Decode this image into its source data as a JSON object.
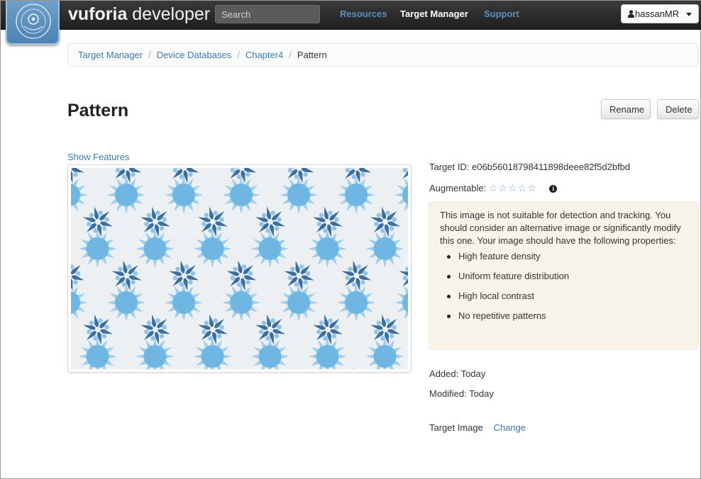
{
  "navbar": {
    "brand_bold": "vuforia",
    "brand_rest": " developer",
    "search_placeholder": "Search",
    "links": [
      {
        "label": "Resources",
        "active": false
      },
      {
        "label": "Target Manager",
        "active": true
      },
      {
        "label": "Support",
        "active": false
      }
    ],
    "user": "hassanMR"
  },
  "breadcrumb": {
    "items": [
      "Target Manager",
      "Device Databases",
      "Chapter4"
    ],
    "separator": "/",
    "current": "Pattern"
  },
  "page": {
    "title": "Pattern",
    "rename_label": "Rename",
    "delete_label": "Delete",
    "show_features": "Show Features"
  },
  "details": {
    "target_id_label": "Target ID:",
    "target_id": "e06b56018798411898deee82f5d2bfbd",
    "augmentable_label": "Augmentable:",
    "augmentable_rating": 0,
    "augmentable_max": 5,
    "warning_text": "This image is not suitable for detection and tracking. You should consider an alternative image or significantly modify this one. Your image should have the following properties:",
    "properties": [
      "High feature density",
      "Uniform feature distribution",
      "High local contrast",
      "No repetitive patterns"
    ],
    "added": "Added: Today",
    "modified": "Modified: Today",
    "target_image_label": "Target Image",
    "change_label": "Change"
  },
  "colors": {
    "link": "#3d7ab0",
    "nav_link": "#5b8fc4",
    "warning_bg": "#f8f4ea",
    "snowflake_light": "#6fb6e2",
    "snowflake_dark": "#3d6f9e"
  },
  "icons": {
    "logo": "vuforia-logo-icon",
    "user": "user-icon",
    "info": "info-icon",
    "caret": "caret-down-icon"
  }
}
